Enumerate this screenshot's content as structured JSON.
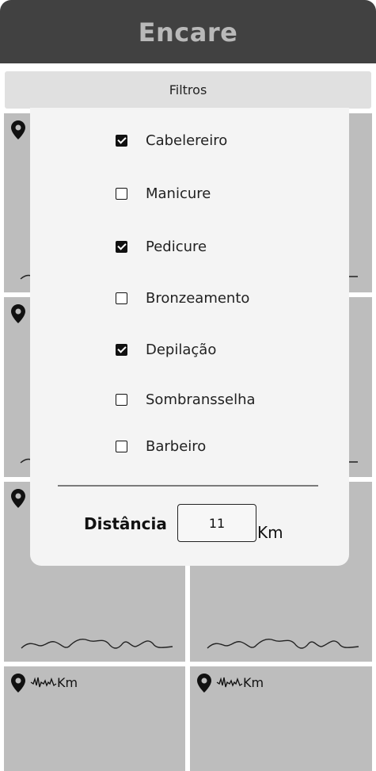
{
  "header": {
    "title": "Encare"
  },
  "filters": {
    "button_label": "Filtros",
    "options": [
      {
        "label": "Cabelereiro",
        "checked": true
      },
      {
        "label": "Manicure",
        "checked": false
      },
      {
        "label": "Pedicure",
        "checked": true
      },
      {
        "label": "Bronzeamento",
        "checked": false
      },
      {
        "label": "Depilação",
        "checked": true
      },
      {
        "label": "Sombransselha",
        "checked": false
      },
      {
        "label": "Barbeiro",
        "checked": false
      }
    ],
    "distance": {
      "label": "Distância",
      "value": "11",
      "unit": "Km"
    }
  },
  "cards": {
    "distance_unit": "Km",
    "icon": "location-pin-icon",
    "text_placeholder": "squiggle-placeholder",
    "distance_placeholder": "squiggle-placeholder"
  },
  "colors": {
    "header_bg": "#414141",
    "header_text": "#b9b9b9",
    "tile_bg": "#bdbdbd",
    "overlay_bg": "#f4f4f4"
  }
}
